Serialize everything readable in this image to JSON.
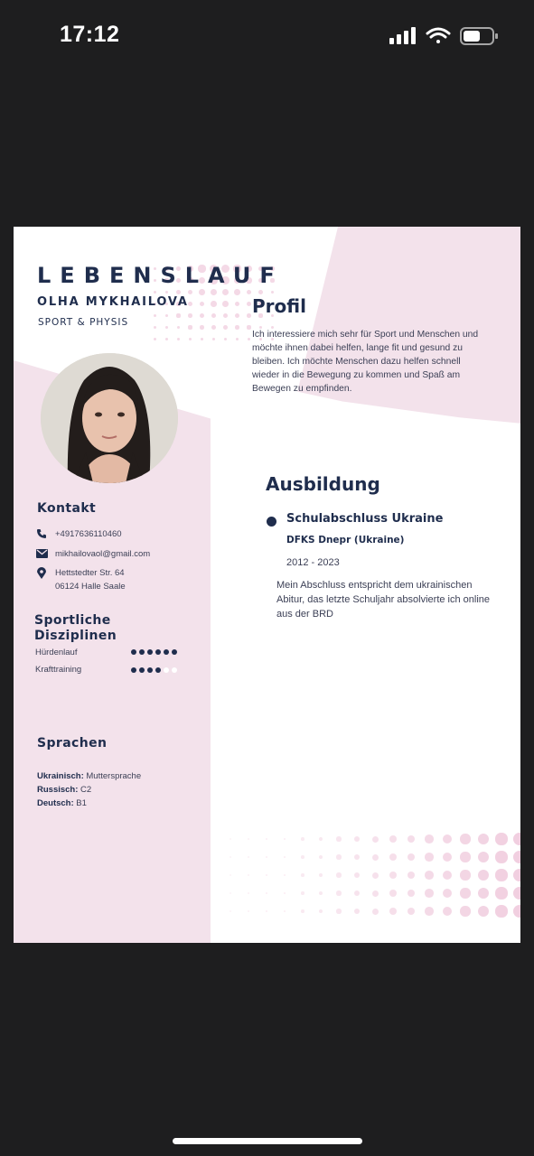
{
  "status_bar": {
    "time": "17:12"
  },
  "resume": {
    "title": "LEBENSLAUF",
    "name": "OLHA MYKHAILOVA",
    "subtitle": "SPORT & PHYSIS",
    "contact": {
      "heading": "Kontakt",
      "phone": "+4917636110460",
      "email": "mikhailovaol@gmail.com",
      "address_line1": "Hettstedter Str. 64",
      "address_line2": "06124 Halle Saale"
    },
    "disciplines": {
      "heading_line1": "Sportliche",
      "heading_line2": "Disziplinen",
      "items": [
        {
          "label": "Hürdenlauf",
          "level": 6,
          "max": 6
        },
        {
          "label": "Krafttraining",
          "level": 4,
          "max": 6
        }
      ]
    },
    "languages": {
      "heading": "Sprachen",
      "items": [
        {
          "name": "Ukrainisch:",
          "level": "Muttersprache"
        },
        {
          "name": "Russisch:",
          "level": "C2"
        },
        {
          "name": "Deutsch:",
          "level": "B1"
        }
      ]
    },
    "profile": {
      "heading": "Profil",
      "text": "Ich interessiere mich sehr für Sport und Menschen und möchte ihnen dabei helfen, lange fit und gesund zu bleiben. Ich möchte Menschen dazu helfen schnell wieder in die Bewegung zu kommen und Spaß am Bewegen zu empfinden."
    },
    "education": {
      "heading": "Ausbildung",
      "school": "Schulabschluss Ukraine",
      "institution": "DFKS Dnepr (Ukraine)",
      "years": "2012 - 2023",
      "description": "Mein Abschluss entspricht dem ukrainischen Abitur, das letzte Schuljahr absolvierte ich online aus der BRD"
    }
  },
  "colors": {
    "navy": "#1f2d4d",
    "pink": "#f3e2eb",
    "dot_pink": "#f1cfe0"
  }
}
